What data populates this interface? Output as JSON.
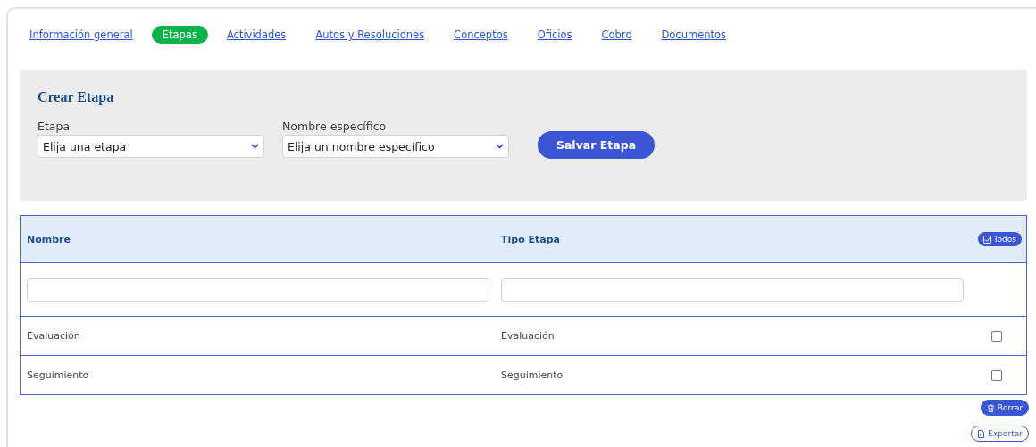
{
  "tabs": [
    {
      "label": "Información general",
      "selected": false
    },
    {
      "label": "Etapas",
      "selected": true
    },
    {
      "label": "Actividades",
      "selected": false
    },
    {
      "label": "Autos y Resoluciones",
      "selected": false
    },
    {
      "label": "Conceptos",
      "selected": false
    },
    {
      "label": "Oficios",
      "selected": false
    },
    {
      "label": "Cobro",
      "selected": false
    },
    {
      "label": "Documentos",
      "selected": false
    }
  ],
  "form": {
    "title": "Crear Etapa",
    "fields": [
      {
        "label": "Etapa",
        "value": "Elija una etapa"
      },
      {
        "label": "Nombre específico",
        "value": "Elija un nombre específico"
      }
    ],
    "submit": "Salvar Etapa"
  },
  "table": {
    "columns": [
      "Nombre",
      "Tipo Etapa"
    ],
    "select_all": "Todos",
    "rows": [
      {
        "cells": [
          "Evaluación",
          "Evaluación"
        ],
        "checked": false
      },
      {
        "cells": [
          "Seguimiento",
          "Seguimiento"
        ],
        "checked": false
      }
    ]
  },
  "actions": [
    "Borrar",
    "Exportar"
  ]
}
